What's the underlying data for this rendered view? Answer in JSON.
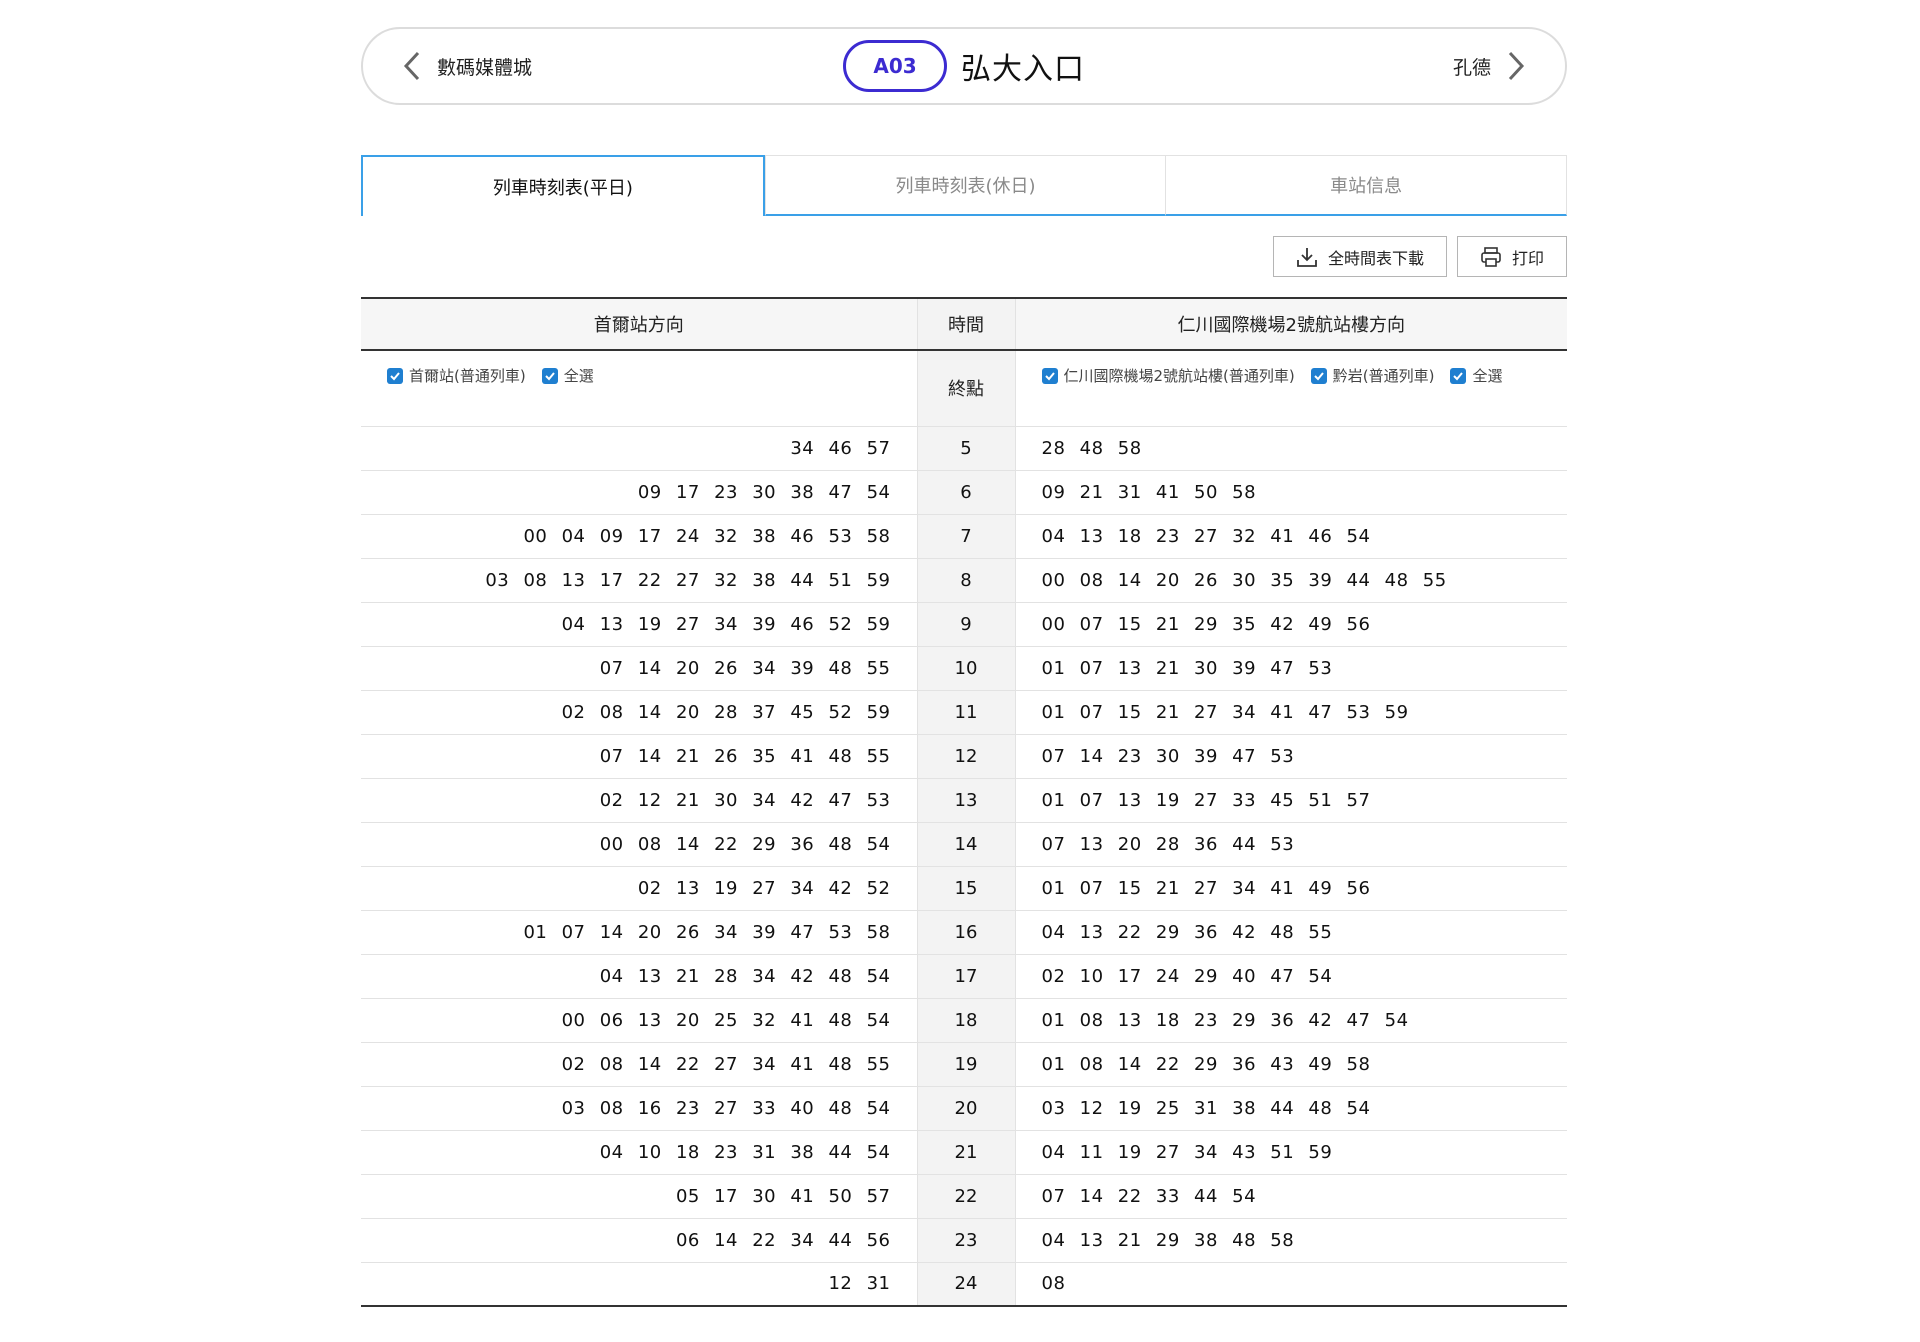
{
  "header": {
    "prev_station": "數碼媒體城",
    "next_station": "孔德",
    "line_code": "A03",
    "station_name": "弘大入口"
  },
  "tabs": [
    {
      "label": "列車時刻表(平日)",
      "active": true
    },
    {
      "label": "列車時刻表(休日)",
      "active": false
    },
    {
      "label": "車站信息",
      "active": false
    }
  ],
  "tools": {
    "download_label": "全時間表下載",
    "print_label": "打印"
  },
  "table": {
    "left_header": "首爾站方向",
    "time_header": "時間",
    "right_header": "仁川國際機場2號航站樓方向",
    "terminal_label": "終點",
    "left_filters": [
      "首爾站(普通列車)",
      "全選"
    ],
    "right_filters": [
      "仁川國際機場2號航站樓(普通列車)",
      "黔岩(普通列車)",
      "全選"
    ],
    "rows": [
      {
        "hour": "5",
        "left": "34 46 57",
        "right": "28 48 58"
      },
      {
        "hour": "6",
        "left": "09 17 23 30 38 47 54",
        "right": "09 21 31 41 50 58"
      },
      {
        "hour": "7",
        "left": "00 04 09 17 24 32 38 46 53 58",
        "right": "04 13 18 23 27 32 41 46 54"
      },
      {
        "hour": "8",
        "left": "03 08 13 17 22 27 32 38 44 51 59",
        "right": "00 08 14 20 26 30 35 39 44 48 55"
      },
      {
        "hour": "9",
        "left": "04 13 19 27 34 39 46 52 59",
        "right": "00 07 15 21 29 35 42 49 56"
      },
      {
        "hour": "10",
        "left": "07 14 20 26 34 39 48 55",
        "right": "01 07 13 21 30 39 47 53"
      },
      {
        "hour": "11",
        "left": "02 08 14 20 28 37 45 52 59",
        "right": "01 07 15 21 27 34 41 47 53 59"
      },
      {
        "hour": "12",
        "left": "07 14 21 26 35 41 48 55",
        "right": "07 14 23 30 39 47 53"
      },
      {
        "hour": "13",
        "left": "02 12 21 30 34 42 47 53",
        "right": "01 07 13 19 27 33 45 51 57"
      },
      {
        "hour": "14",
        "left": "00 08 14 22 29 36 48 54",
        "right": "07 13 20 28 36 44 53"
      },
      {
        "hour": "15",
        "left": "02 13 19 27 34 42 52",
        "right": "01 07 15 21 27 34 41 49 56"
      },
      {
        "hour": "16",
        "left": "01 07 14 20 26 34 39 47 53 58",
        "right": "04 13 22 29 36 42 48 55"
      },
      {
        "hour": "17",
        "left": "04 13 21 28 34 42 48 54",
        "right": "02 10 17 24 29 40 47 54"
      },
      {
        "hour": "18",
        "left": "00 06 13 20 25 32 41 48 54",
        "right": "01 08 13 18 23 29 36 42 47 54"
      },
      {
        "hour": "19",
        "left": "02 08 14 22 27 34 41 48 55",
        "right": "01 08 14 22 29 36 43 49 58"
      },
      {
        "hour": "20",
        "left": "03 08 16 23 27 33 40 48 54",
        "right": "03 12 19 25 31 38 44 48 54"
      },
      {
        "hour": "21",
        "left": "04 10 18 23 31 38 44 54",
        "right": "04 11 19 27 34 43 51 59"
      },
      {
        "hour": "22",
        "left": "05 17 30 41 50 57",
        "right": "07 14 22 33 44 54"
      },
      {
        "hour": "23",
        "left": "06 14 22 34 44 56",
        "right": "04 13 21 29 38 48 58"
      },
      {
        "hour": "24",
        "left": "12 31",
        "right": "08"
      }
    ]
  },
  "colors": {
    "accent_blue": "#3aa0e8",
    "line_badge": "#3c2bd1",
    "checkbox": "#1f7fd0"
  }
}
